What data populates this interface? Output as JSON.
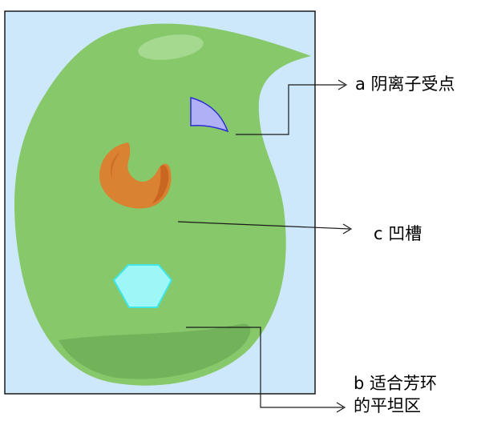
{
  "colors": {
    "background": "#cde8fb",
    "frame": "#1a1a1a",
    "cell_body": "#87c96a",
    "highlight": "#a4d98f",
    "bottom_shade": "#6fae58",
    "site_a_fill": "#b0b0f6",
    "site_a_stroke": "#2d2dd6",
    "crescent_fill": "#d88232",
    "crescent_highlight": "#c65f1e",
    "hexagon_fill": "#9ff6f6",
    "hexagon_stroke": "#3fe6e6",
    "leader_line": "#1a1a1a"
  },
  "labels": {
    "a": "a 阴离子受点",
    "c": "c  凹槽",
    "b_line1": "b 适合芳环",
    "b_line2": "的平坦区"
  }
}
